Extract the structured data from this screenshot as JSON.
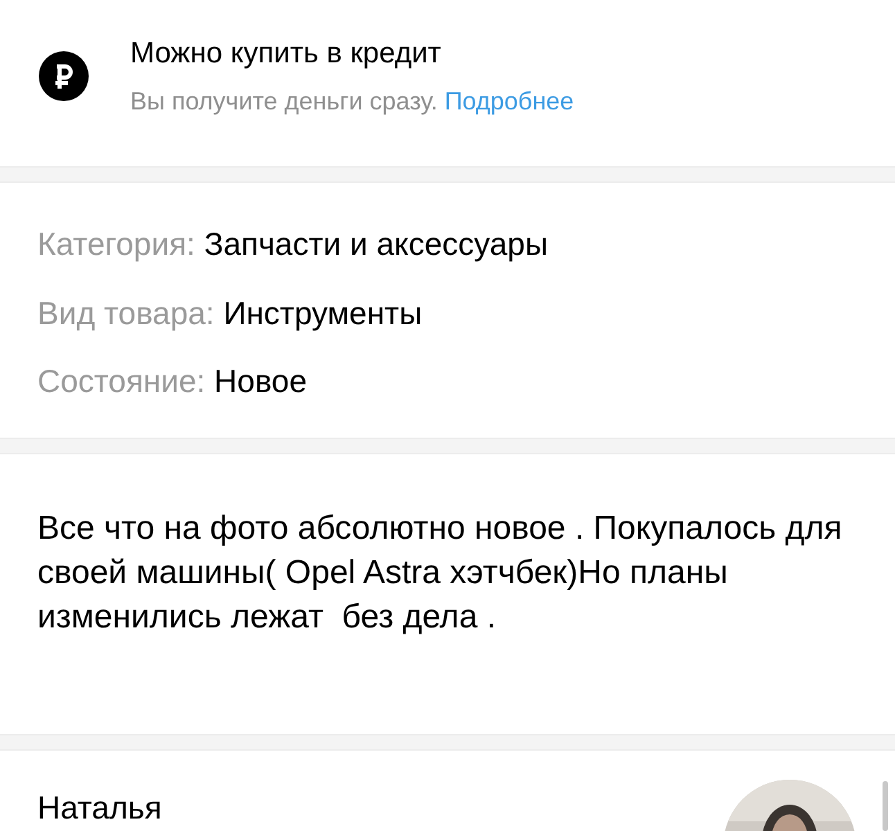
{
  "credit": {
    "title": "Можно купить в кредит",
    "subtitle": "Вы получите деньги сразу.",
    "link": "Подробнее"
  },
  "params": [
    {
      "label": "Категория:",
      "value": "Запчасти и аксессуары"
    },
    {
      "label": "Вид товара:",
      "value": "Инструменты"
    },
    {
      "label": "Состояние:",
      "value": "Новое"
    }
  ],
  "description": "Все что на фото абсолютно новое . Покупалось для своей машины( Opel Astra хэтчбек)Но планы изменились лежат  без дела .",
  "seller": {
    "name": "Наталья"
  }
}
